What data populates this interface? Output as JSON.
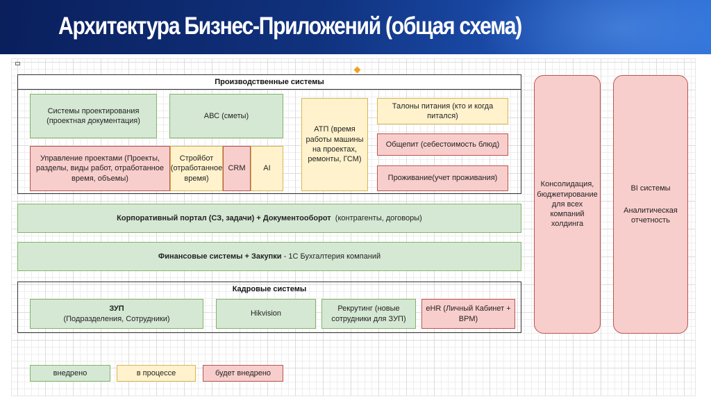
{
  "title": "Архитектура Бизнес-Приложений (общая схема)",
  "production": {
    "title": "Производственные системы",
    "design_systems": "Системы проектирования (проектная документация)",
    "abc": "АВС (сметы)",
    "atp": "АТП (время работы машины на проектах, ремонты, ГСМ)",
    "meal_tickets": "Талоны питания (кто и когда питался)",
    "catering": "Общепит (себестоимость блюд)",
    "accommodation": "Проживание(учет проживания)",
    "project_mgmt": "Управление проектами (Проекты, разделы, виды работ, отработанное время, объемы)",
    "stroybot": "Стройбот (отработанное время)",
    "crm": "CRM",
    "ai": "AI"
  },
  "portal": {
    "bold": "Корпоративный портал (СЗ, задачи) + Документооборот",
    "normal": "(контрагенты, договоры)"
  },
  "finance": {
    "bold": "Финансовые системы + Закупки",
    "normal": "-  1С Бухгалтерия компаний"
  },
  "hr": {
    "title": "Кадровые системы",
    "zup_title": "ЗУП",
    "zup_sub": "(Подразделения, Сотрудники)",
    "hikvision": "Hikvision",
    "recruiting": "Рекрутинг (новые сотрудники для ЗУП)",
    "ehr": "eHR (Личный Кабинет + ВРМ)"
  },
  "consolidation": "Консолидация, бюджетирование для всех компаний холдинга",
  "bi": {
    "title": "BI системы",
    "sub": "Аналитическая отчетность"
  },
  "legend": {
    "implemented": "внедрено",
    "in_progress": "в процессе",
    "planned": "будет внедрено"
  },
  "colors": {
    "implemented": "#d5e8d4",
    "in_progress": "#fff2cc",
    "planned": "#f8cecc",
    "header": "#10327e"
  }
}
